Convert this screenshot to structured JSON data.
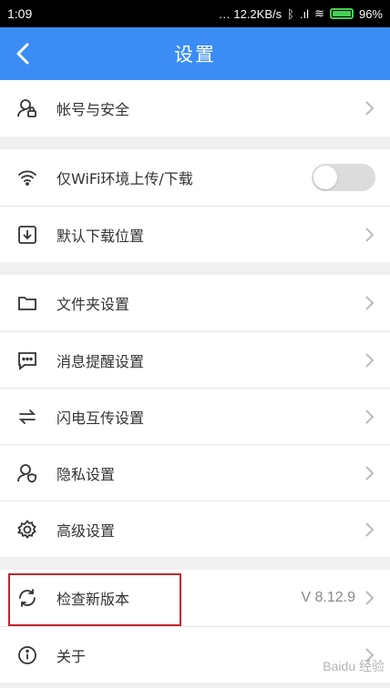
{
  "status": {
    "time": "1:09",
    "speed": "12.2KB/s",
    "battery": "96%"
  },
  "header": {
    "title": "设置"
  },
  "groups": [
    {
      "items": [
        {
          "label": "帐号与安全",
          "icon": "account-lock-icon"
        }
      ]
    },
    {
      "items": [
        {
          "label": "仅WiFi环境上传/下载",
          "icon": "wifi-icon",
          "toggle": false
        },
        {
          "label": "默认下载位置",
          "icon": "download-icon"
        }
      ]
    },
    {
      "items": [
        {
          "label": "文件夹设置",
          "icon": "folder-icon"
        },
        {
          "label": "消息提醒设置",
          "icon": "message-icon"
        },
        {
          "label": "闪电互传设置",
          "icon": "transfer-icon"
        },
        {
          "label": "隐私设置",
          "icon": "privacy-icon"
        },
        {
          "label": "高级设置",
          "icon": "gear-icon"
        }
      ]
    },
    {
      "items": [
        {
          "label": "检查新版本",
          "icon": "refresh-icon",
          "value": "V 8.12.9"
        },
        {
          "label": "关于",
          "icon": "info-icon"
        }
      ]
    }
  ],
  "watermark": "Baidu 经验",
  "colors": {
    "accent": "#3b8df5",
    "highlight": "#c0262d"
  }
}
